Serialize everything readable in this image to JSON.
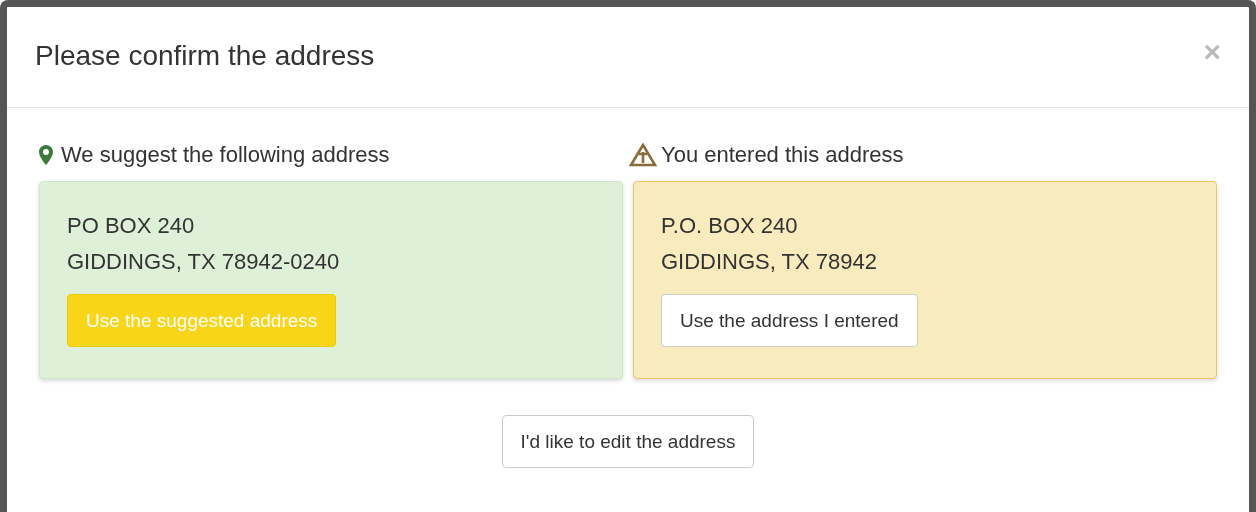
{
  "dialog": {
    "title": "Please confirm the address",
    "close": "×"
  },
  "options": [
    {
      "kind": "suggested",
      "heading": "We suggest the following address",
      "lines": [
        "PO BOX 240",
        "GIDDINGS, TX 78942-0240"
      ],
      "button": "Use the suggested address"
    },
    {
      "kind": "entered",
      "heading": "You entered this address",
      "lines": [
        "P.O. BOX 240",
        "GIDDINGS, TX 78942"
      ],
      "button": "Use the address I entered"
    }
  ],
  "edit_button": "I'd like to edit the address"
}
